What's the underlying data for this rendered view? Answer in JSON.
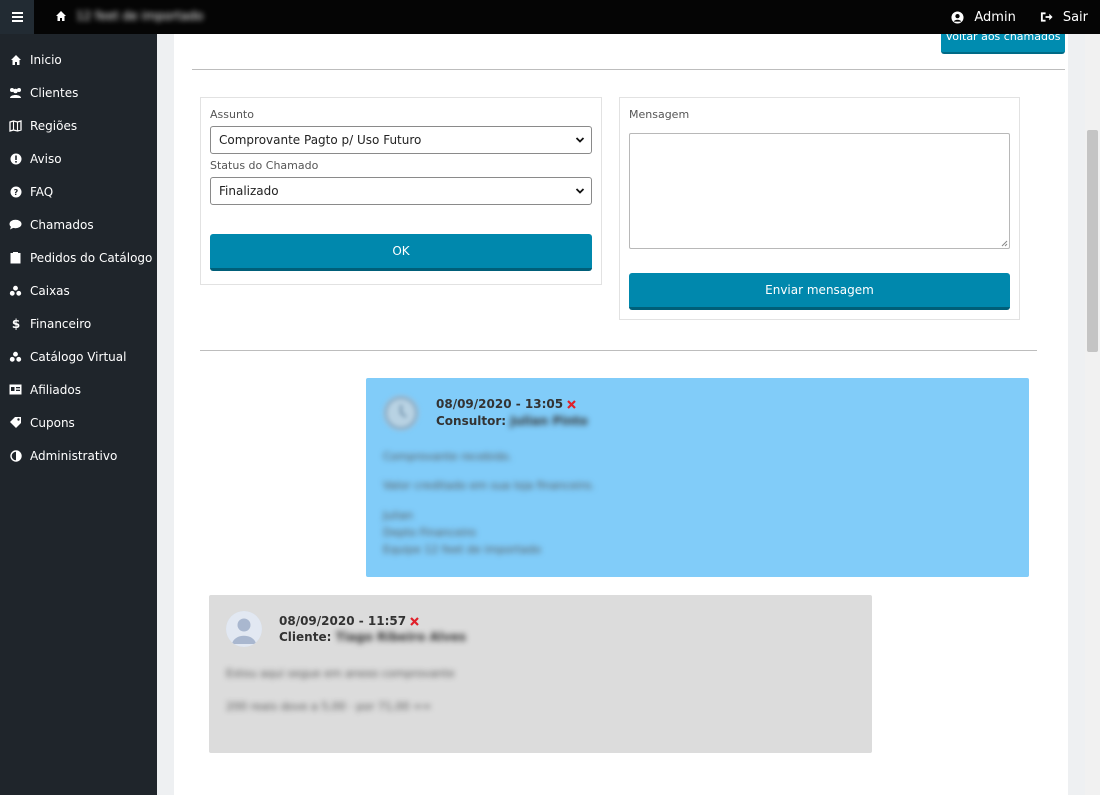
{
  "topbar": {
    "brand_text": "12 feet de importado",
    "user_label": "Admin",
    "logout_label": "Sair"
  },
  "sidebar": {
    "items": [
      {
        "label": "Inicio",
        "icon": "home-icon"
      },
      {
        "label": "Clientes",
        "icon": "users-icon"
      },
      {
        "label": "Regiões",
        "icon": "map-icon"
      },
      {
        "label": "Aviso",
        "icon": "alert-icon"
      },
      {
        "label": "FAQ",
        "icon": "question-icon"
      },
      {
        "label": "Chamados",
        "icon": "chat-icon"
      },
      {
        "label": "Pedidos do Catálogo",
        "icon": "clipboard-icon"
      },
      {
        "label": "Caixas",
        "icon": "cubes-icon"
      },
      {
        "label": "Financeiro",
        "icon": "dollar-icon"
      },
      {
        "label": "Catálogo Virtual",
        "icon": "cubes-icon"
      },
      {
        "label": "Afiliados",
        "icon": "id-card-icon"
      },
      {
        "label": "Cupons",
        "icon": "ticket-icon"
      },
      {
        "label": "Administrativo",
        "icon": "adjust-icon"
      }
    ]
  },
  "header": {
    "back_button_label": "Voltar aos chamados"
  },
  "ticket_form": {
    "subject_label": "Assunto",
    "subject_value": "Comprovante Pagto p/ Uso Futuro",
    "status_label": "Status do Chamado",
    "status_value": "Finalizado",
    "ok_label": "OK"
  },
  "message_form": {
    "label": "Mensagem",
    "value": "",
    "send_label": "Enviar mensagem"
  },
  "messages": [
    {
      "date": "08/09/2020 - 13:05",
      "role": "Consultor:",
      "author": "Julian Pinto",
      "lines": [
        "Comprovante recebido.",
        "Valor creditado em sua loja financeiro.",
        "Julian",
        "Depto Financeiro",
        "Equipe 12 feet de importado"
      ],
      "color": "#81ccf9"
    },
    {
      "date": "08/09/2020 - 11:57",
      "role": "Cliente:",
      "author": "Tiago Ribeiro Alves",
      "lines": [
        "Estou aqui segue em anexo comprovante",
        "200 reais dove a 5,00 · por 71,00 =="
      ],
      "color": "#dcdcdc"
    }
  ],
  "colors": {
    "topbar": "#050505",
    "sidebar": "#1f252b",
    "primary_button": "#0088ad",
    "delete_icon": "#e0202a"
  }
}
